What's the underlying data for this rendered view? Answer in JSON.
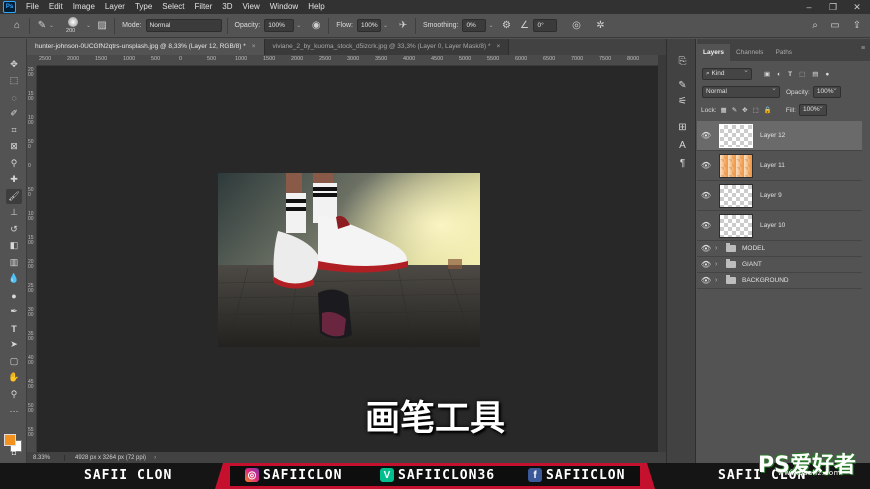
{
  "app": {
    "logo": "Ps"
  },
  "menu": [
    "File",
    "Edit",
    "Image",
    "Layer",
    "Type",
    "Select",
    "Filter",
    "3D",
    "View",
    "Window",
    "Help"
  ],
  "options": {
    "brush_size": "200",
    "mode_label": "Mode:",
    "mode_value": "Normal",
    "opacity_label": "Opacity:",
    "opacity_value": "100%",
    "flow_label": "Flow:",
    "flow_value": "100%",
    "smoothing_label": "Smoothing:",
    "smoothing_value": "0%",
    "angle_value": "0°"
  },
  "tabs": [
    {
      "label": "hunter-johnson-0UCGfN2qtrs-unsplash.jpg @ 8,33% (Layer 12, RGB/8) *",
      "close": "×"
    },
    {
      "label": "viviane_2_by_kuoma_stock_d5izcrk.jpg @ 33,3% (Layer 0, Layer Mask/8) *",
      "close": "×"
    }
  ],
  "ruler_h": [
    "2500",
    "2000",
    "1500",
    "1000",
    "500",
    "0",
    "500",
    "1000",
    "1500",
    "2000",
    "2500",
    "3000",
    "3500",
    "4000",
    "4500",
    "5000",
    "5500",
    "6000",
    "6500",
    "7000",
    "7500",
    "8000"
  ],
  "ruler_v": [
    "2000",
    "1500",
    "1000",
    "500",
    "0",
    "500",
    "1000",
    "1500",
    "2000",
    "2500",
    "3000",
    "3500",
    "4000",
    "4500",
    "5000",
    "5500"
  ],
  "status": {
    "zoom": "8.33%",
    "doc_info": "4928 px x 3264 px (72 ppi)",
    "arrow": "›"
  },
  "subtitle": "画笔工具",
  "layers_panel": {
    "tabs": [
      "Layers",
      "Channels",
      "Paths"
    ],
    "filter_value": "Kind",
    "blend_value": "Normal",
    "opacity_label": "Opacity:",
    "opacity_value": "100%",
    "lock_label": "Lock:",
    "fill_label": "Fill:",
    "fill_value": "100%",
    "layers": [
      {
        "name": "Layer 12",
        "selected": true
      },
      {
        "name": "Layer 11",
        "selected": false
      },
      {
        "name": "Layer 9",
        "selected": false
      },
      {
        "name": "Layer 10",
        "selected": false
      }
    ],
    "groups": [
      "MODEL",
      "GIANT",
      "BACKGROUND"
    ]
  },
  "banner": {
    "left_text": "SAFII CLON",
    "instagram": "SAFIICLON",
    "vine": "SAFIICLON36",
    "facebook": "SAFIICLON",
    "right_text": "SAFII CLON"
  },
  "watermark": {
    "main": "PS爱好者",
    "sub": "www.psahz.com"
  },
  "colors": {
    "foreground": "#f39221",
    "background": "#ffffff",
    "banner_red": "#c5102e"
  },
  "icons": {
    "toolbar": [
      "move-icon",
      "marquee-icon",
      "lasso-icon",
      "quick-select-icon",
      "crop-icon",
      "frame-icon",
      "eyedropper-icon",
      "healing-icon",
      "brush-icon",
      "stamp-icon",
      "history-brush-icon",
      "eraser-icon",
      "gradient-icon",
      "blur-icon",
      "dodge-icon",
      "pen-icon",
      "type-icon",
      "path-select-icon",
      "rectangle-icon",
      "hand-icon",
      "zoom-icon"
    ]
  }
}
